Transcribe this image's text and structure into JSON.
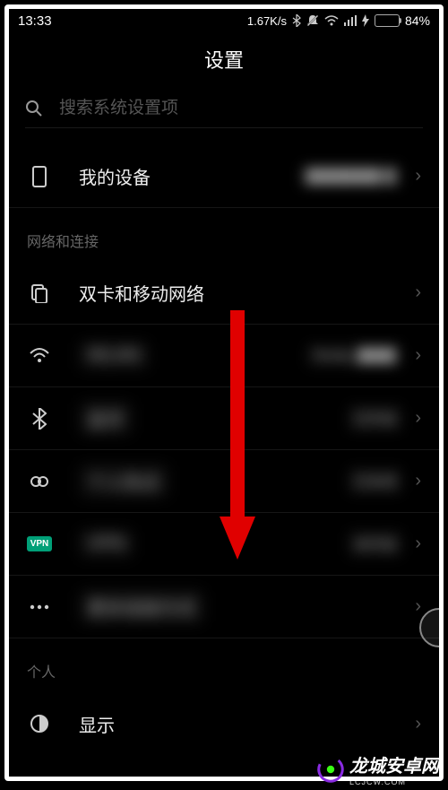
{
  "status": {
    "time": "13:33",
    "net_speed": "1.67K/s",
    "battery_pct": "84%"
  },
  "header": {
    "title": "设置"
  },
  "search": {
    "placeholder": "搜索系统设置项"
  },
  "sections": {
    "device": {
      "my_device_label": "我的设备",
      "my_device_value": "████████ █"
    },
    "network": {
      "header": "网络和连接",
      "dual_sim_label": "双卡和移动网络",
      "wifi_label": "WLAN",
      "wifi_value": "Tenda_████",
      "bt_label": "蓝牙",
      "bt_value": "已开启",
      "hotspot_label": "个人热点",
      "hotspot_value": "已关闭",
      "vpn_badge": "VPN",
      "vpn_label": "VPN",
      "vpn_value": "未开启",
      "more_label": "更多连接方式"
    },
    "personal": {
      "header": "个人",
      "display_label": "显示"
    }
  },
  "watermark": {
    "text": "龙城安卓网",
    "sub": "LCJCW.COM"
  }
}
